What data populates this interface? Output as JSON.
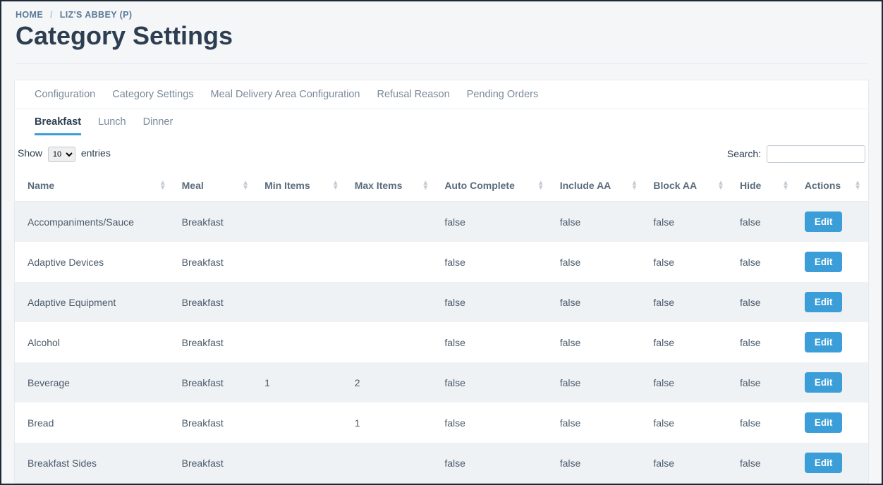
{
  "breadcrumb": {
    "home": "HOME",
    "facility": "LIZ'S ABBEY (P)"
  },
  "page_title": "Category Settings",
  "tabs_top": [
    "Configuration",
    "Category Settings",
    "Meal Delivery Area Configuration",
    "Refusal Reason",
    "Pending Orders"
  ],
  "subtabs": [
    "Breakfast",
    "Lunch",
    "Dinner"
  ],
  "subtab_active_index": 0,
  "table_controls": {
    "show_label_pre": "Show",
    "show_label_post": "entries",
    "show_value": "10",
    "search_label": "Search:"
  },
  "columns": [
    "Name",
    "Meal",
    "Min Items",
    "Max Items",
    "Auto Complete",
    "Include AA",
    "Block AA",
    "Hide",
    "Actions"
  ],
  "rows": [
    {
      "name": "Accompaniments/Sauce",
      "meal": "Breakfast",
      "min": "",
      "max": "",
      "auto": "false",
      "inc": "false",
      "blk": "false",
      "hide": "false"
    },
    {
      "name": "Adaptive Devices",
      "meal": "Breakfast",
      "min": "",
      "max": "",
      "auto": "false",
      "inc": "false",
      "blk": "false",
      "hide": "false"
    },
    {
      "name": "Adaptive Equipment",
      "meal": "Breakfast",
      "min": "",
      "max": "",
      "auto": "false",
      "inc": "false",
      "blk": "false",
      "hide": "false"
    },
    {
      "name": "Alcohol",
      "meal": "Breakfast",
      "min": "",
      "max": "",
      "auto": "false",
      "inc": "false",
      "blk": "false",
      "hide": "false"
    },
    {
      "name": "Beverage",
      "meal": "Breakfast",
      "min": "1",
      "max": "2",
      "auto": "false",
      "inc": "false",
      "blk": "false",
      "hide": "false"
    },
    {
      "name": "Bread",
      "meal": "Breakfast",
      "min": "",
      "max": "1",
      "auto": "false",
      "inc": "false",
      "blk": "false",
      "hide": "false"
    },
    {
      "name": "Breakfast Sides",
      "meal": "Breakfast",
      "min": "",
      "max": "",
      "auto": "false",
      "inc": "false",
      "blk": "false",
      "hide": "false"
    }
  ],
  "edit_label": "Edit"
}
